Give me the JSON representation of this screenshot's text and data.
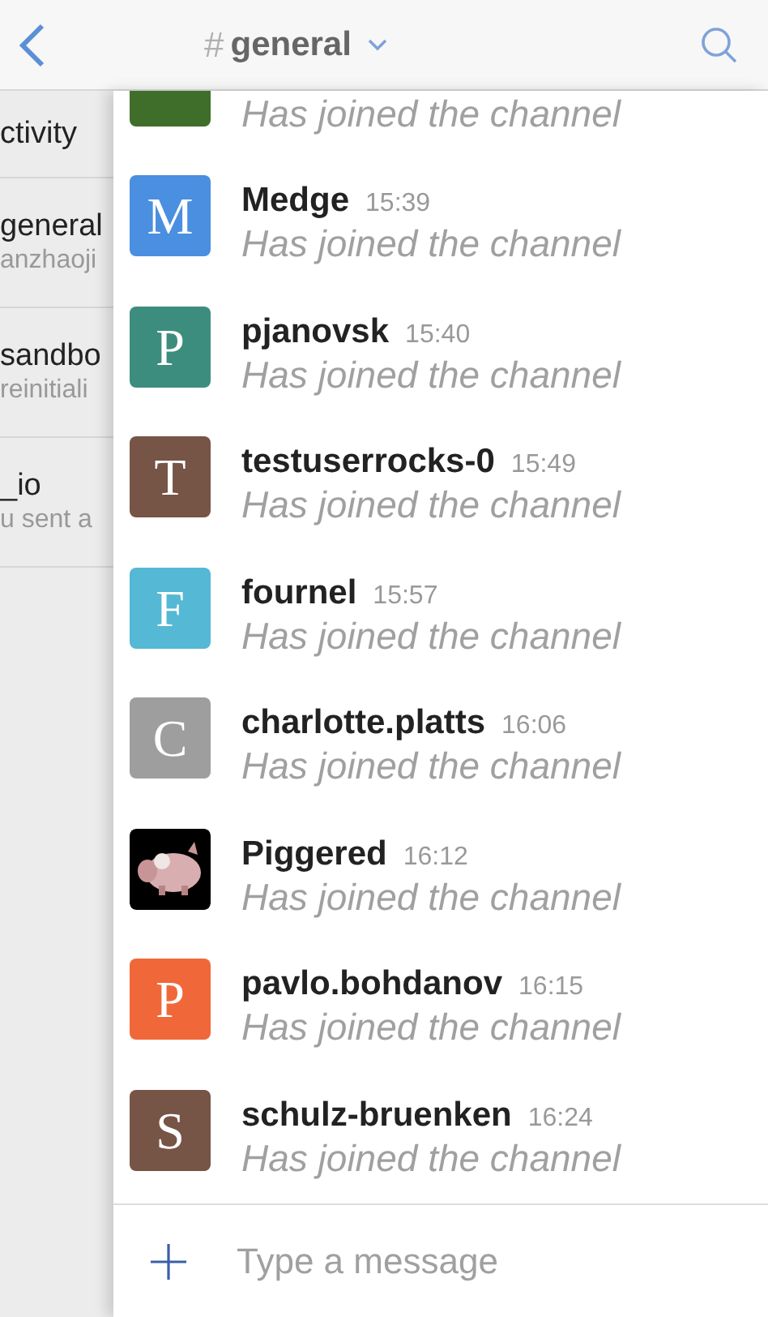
{
  "header": {
    "channel_prefix": "#",
    "channel": "general"
  },
  "sidebar": {
    "items": [
      {
        "title": "ctivity"
      },
      {
        "title": "general",
        "subtitle": "anzhaoji"
      },
      {
        "title": "sandbo",
        "subtitle": "reinitiali"
      },
      {
        "title": "_io",
        "subtitle": "u sent a"
      }
    ]
  },
  "messages": [
    {
      "kind": "letter",
      "color": "#3f6e2a",
      "text": "Has joined the channel"
    },
    {
      "kind": "letter",
      "letter": "M",
      "color": "#4a8fe0",
      "name": "Medge",
      "time": "15:39",
      "text": "Has joined the channel"
    },
    {
      "kind": "letter",
      "letter": "P",
      "color": "#3d8d7f",
      "name": "pjanovsk",
      "time": "15:40",
      "text": "Has joined the channel"
    },
    {
      "kind": "letter",
      "letter": "T",
      "color": "#765446",
      "name": "testuserrocks-0",
      "time": "15:49",
      "text": "Has joined the channel"
    },
    {
      "kind": "letter",
      "letter": "F",
      "color": "#55b8d4",
      "name": "fournel",
      "time": "15:57",
      "text": "Has joined the channel"
    },
    {
      "kind": "letter",
      "letter": "C",
      "color": "#9e9e9e",
      "name": "charlotte.platts",
      "time": "16:06",
      "text": "Has joined the channel"
    },
    {
      "kind": "picture",
      "name": "Piggered",
      "time": "16:12",
      "text": "Has joined the channel"
    },
    {
      "kind": "letter",
      "letter": "P",
      "color": "#f0683a",
      "name": "pavlo.bohdanov",
      "time": "16:15",
      "text": "Has joined the channel"
    },
    {
      "kind": "letter",
      "letter": "S",
      "color": "#765446",
      "name": "schulz-bruenken",
      "time": "16:24",
      "text": "Has joined the channel"
    }
  ],
  "composer": {
    "placeholder": "Type a message"
  }
}
